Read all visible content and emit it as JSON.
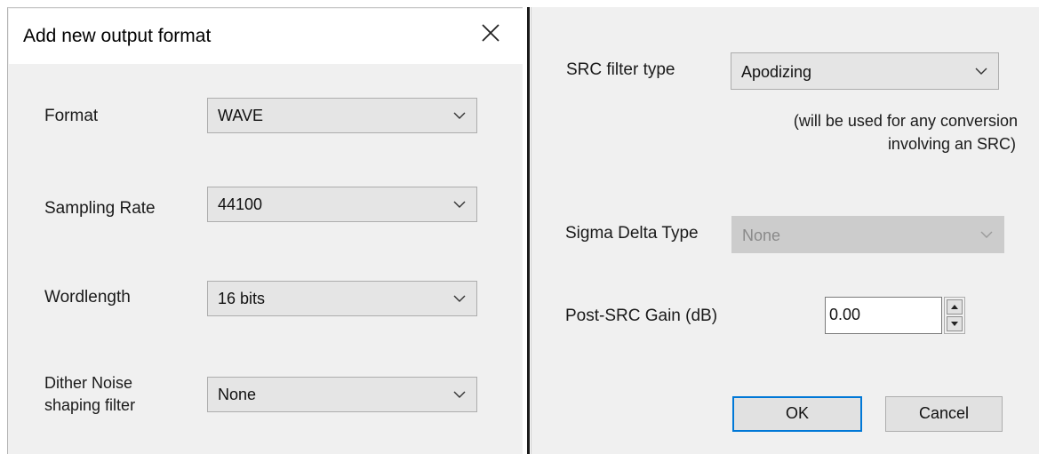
{
  "left_dialog": {
    "title": "Add new output format",
    "close_icon": "close-icon",
    "fields": [
      {
        "label": "Format",
        "value": "WAVE"
      },
      {
        "label": "Sampling Rate",
        "value": "44100"
      },
      {
        "label": "Wordlength",
        "value": "16 bits"
      },
      {
        "label_line1": "Dither Noise",
        "label_line2": "shaping filter",
        "value": "None"
      }
    ]
  },
  "right_panel": {
    "src_filter": {
      "label": "SRC filter type",
      "value": "Apodizing"
    },
    "note_line1": "(will be used for any conversion",
    "note_line2": "involving an SRC)",
    "sigma_delta": {
      "label": "Sigma Delta Type",
      "value": "None",
      "disabled": true
    },
    "post_gain": {
      "label": "Post-SRC Gain (dB)",
      "value": "0.00"
    },
    "ok_label": "OK",
    "cancel_label": "Cancel"
  },
  "colors": {
    "dialog_bg": "#f0f0f0",
    "combo_bg": "#e5e5e5",
    "default_button_border": "#0078d7",
    "disabled_text": "#8a8a8a"
  }
}
